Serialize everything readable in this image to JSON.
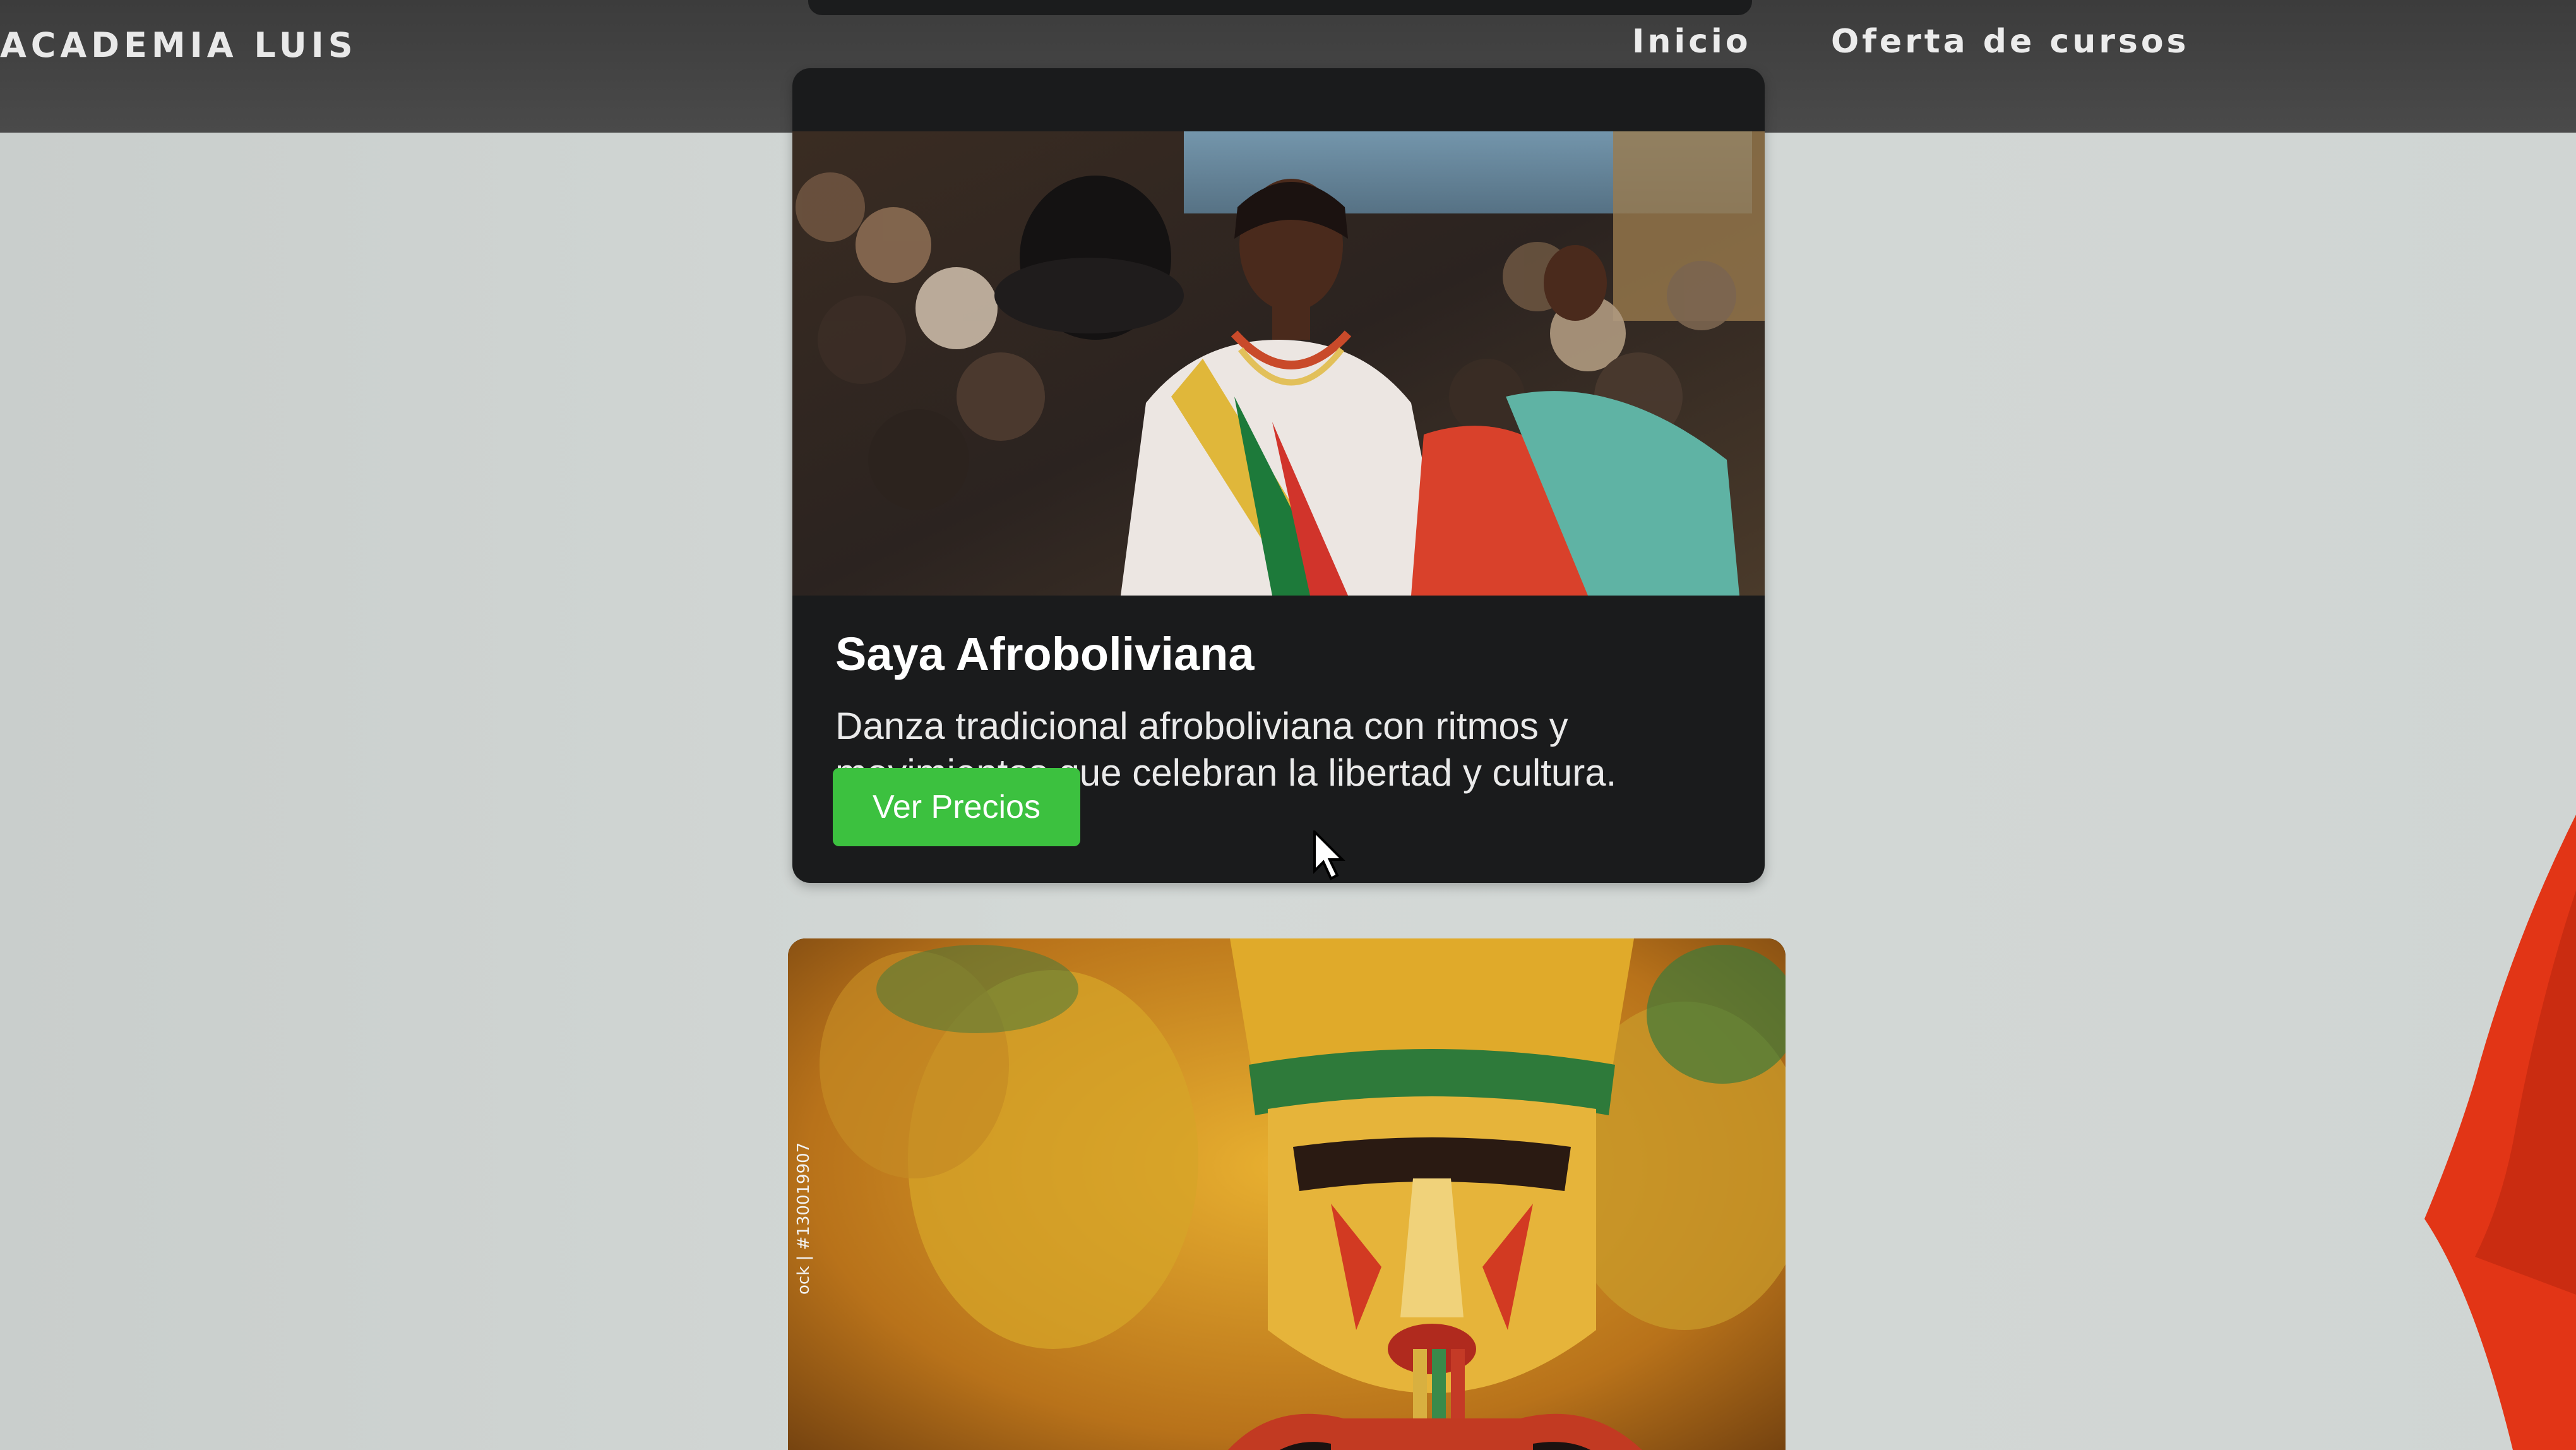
{
  "nav": {
    "brand": "ACADEMIA LUIS",
    "links": [
      {
        "label": "Inicio"
      },
      {
        "label": "Oferta de cursos"
      }
    ]
  },
  "cards": [
    {
      "title": "Saya Afroboliviana",
      "description": "Danza tradicional afroboliviana con ritmos y movimientos que celebran la libertad y cultura.",
      "button_label": "Ver Precios",
      "image_alt": "Bailarina de Saya Afroboliviana con sombrero y traje tradicional"
    },
    {
      "image_alt": "Danzante con máscara tradicional",
      "watermark": "ock | #130019907"
    }
  ],
  "colors": {
    "navbar": "#444444",
    "card_bg": "#1a1b1c",
    "button": "#3cc13f",
    "page_bg": "#cfd4d2"
  }
}
